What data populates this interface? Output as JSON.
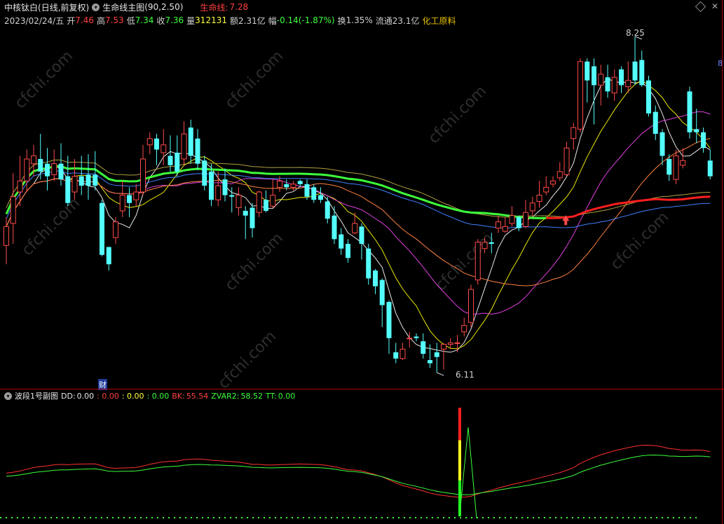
{
  "header": {
    "stock_name": "中核钛白",
    "period_label": "(日线,前复权)",
    "indicator_name": "生命线主图",
    "indicator_params": "(90,2.50)",
    "lifeline_label": "生命线:",
    "lifeline_value": "7.28"
  },
  "info_bar": {
    "date": "2023/02/24/五",
    "open_label": "开",
    "open": "7.46",
    "high_label": "高",
    "high": "7.53",
    "low_label": "低",
    "low": "7.34",
    "close_label": "收",
    "close": "7.36",
    "volume_label": "量",
    "volume": "312131",
    "amount_label": "额",
    "amount": "2.31亿",
    "change_label": "幅",
    "change": "-0.14(-1.87%)",
    "turnover_label": "换",
    "turnover": "1.35%",
    "float_label": "流通",
    "float": "23.1亿",
    "sector": "化工原料"
  },
  "price_annotations": {
    "high": "8.25",
    "low": "6.11"
  },
  "finance_marker": "财",
  "right_axis_label": "8",
  "watermark": "cfchi.com",
  "sub_panel": {
    "title": "波段1号副图",
    "dd_label": "DD:",
    "dd": "0.00",
    "v2": ": 0.00",
    "v3": ": 0.00",
    "v4": ": 0.00",
    "bk_label": "BK:",
    "bk": "55.54",
    "zvar2_label": "ZVAR2:",
    "zvar2": "58.52",
    "tt_label": "TT:",
    "tt": "0.00"
  },
  "colors": {
    "up": "#ff4a4a",
    "down": "#54ffff",
    "lifeline_up": "#ff1e1e",
    "lifeline_down": "#3cff3c",
    "text_red": "#ff4040",
    "text_green": "#3cff3c",
    "text_yellow": "#ffff3c",
    "text_gold": "#e8c000",
    "text_cyan": "#3cffff"
  },
  "chart_data": {
    "type": "candlestick",
    "price_range": [
      6.11,
      8.25
    ],
    "candles": [
      {
        "o": 6.92,
        "c": 7.04,
        "h": 7.1,
        "l": 6.8
      },
      {
        "o": 7.06,
        "c": 7.23,
        "h": 7.38,
        "l": 6.93
      },
      {
        "o": 7.26,
        "c": 7.33,
        "h": 7.49,
        "l": 7.17
      },
      {
        "o": 7.33,
        "c": 7.47,
        "h": 7.53,
        "l": 7.26
      },
      {
        "o": 7.44,
        "c": 7.49,
        "h": 7.56,
        "l": 7.36
      },
      {
        "o": 7.47,
        "c": 7.39,
        "h": 7.63,
        "l": 7.34
      },
      {
        "o": 7.44,
        "c": 7.36,
        "h": 7.54,
        "l": 7.27
      },
      {
        "o": 7.37,
        "c": 7.44,
        "h": 7.53,
        "l": 7.33
      },
      {
        "o": 7.44,
        "c": 7.34,
        "h": 7.57,
        "l": 7.3
      },
      {
        "o": 7.36,
        "c": 7.19,
        "h": 7.49,
        "l": 7.17
      },
      {
        "o": 7.26,
        "c": 7.36,
        "h": 7.47,
        "l": 7.21
      },
      {
        "o": 7.36,
        "c": 7.3,
        "h": 7.49,
        "l": 7.24
      },
      {
        "o": 7.37,
        "c": 7.3,
        "h": 7.5,
        "l": 7.21
      },
      {
        "o": 7.37,
        "c": 7.3,
        "h": 7.52,
        "l": 7.27
      },
      {
        "o": 7.19,
        "c": 6.86,
        "h": 7.21,
        "l": 6.85
      },
      {
        "o": 6.91,
        "c": 6.8,
        "h": 6.91,
        "l": 6.76
      },
      {
        "o": 6.97,
        "c": 7.07,
        "h": 7.1,
        "l": 6.93
      },
      {
        "o": 7.14,
        "c": 7.24,
        "h": 7.33,
        "l": 7.1
      },
      {
        "o": 7.24,
        "c": 7.19,
        "h": 7.29,
        "l": 7.1
      },
      {
        "o": 7.21,
        "c": 7.26,
        "h": 7.31,
        "l": 7.17
      },
      {
        "o": 7.26,
        "c": 7.47,
        "h": 7.56,
        "l": 7.24
      },
      {
        "o": 7.56,
        "c": 7.6,
        "h": 7.64,
        "l": 7.5
      },
      {
        "o": 7.6,
        "c": 7.53,
        "h": 7.63,
        "l": 7.43
      },
      {
        "o": 7.51,
        "c": 7.56,
        "h": 7.66,
        "l": 7.43
      },
      {
        "o": 7.49,
        "c": 7.43,
        "h": 7.62,
        "l": 7.39
      },
      {
        "o": 7.51,
        "c": 7.39,
        "h": 7.62,
        "l": 7.36
      },
      {
        "o": 7.47,
        "c": 7.63,
        "h": 7.71,
        "l": 7.43
      },
      {
        "o": 7.67,
        "c": 7.49,
        "h": 7.72,
        "l": 7.44
      },
      {
        "o": 7.6,
        "c": 7.44,
        "h": 7.66,
        "l": 7.4
      },
      {
        "o": 7.46,
        "c": 7.3,
        "h": 7.49,
        "l": 7.27
      },
      {
        "o": 7.39,
        "c": 7.21,
        "h": 7.44,
        "l": 7.17
      },
      {
        "o": 7.21,
        "c": 7.3,
        "h": 7.39,
        "l": 7.17
      },
      {
        "o": 7.34,
        "c": 7.24,
        "h": 7.41,
        "l": 7.2
      },
      {
        "o": 7.24,
        "c": 7.23,
        "h": 7.29,
        "l": 7.13
      },
      {
        "o": 7.16,
        "c": 7.24,
        "h": 7.29,
        "l": 7.11
      },
      {
        "o": 7.14,
        "c": 7.11,
        "h": 7.17,
        "l": 6.96
      },
      {
        "o": 7.16,
        "c": 7.03,
        "h": 7.19,
        "l": 6.97
      },
      {
        "o": 7.13,
        "c": 7.26,
        "h": 7.27,
        "l": 7.1
      },
      {
        "o": 7.21,
        "c": 7.14,
        "h": 7.27,
        "l": 7.13
      },
      {
        "o": 7.17,
        "c": 7.24,
        "h": 7.34,
        "l": 7.16
      },
      {
        "o": 7.29,
        "c": 7.33,
        "h": 7.36,
        "l": 7.26
      },
      {
        "o": 7.31,
        "c": 7.29,
        "h": 7.34,
        "l": 7.27
      },
      {
        "o": 7.29,
        "c": 7.31,
        "h": 7.33,
        "l": 7.27
      },
      {
        "o": 7.33,
        "c": 7.31,
        "h": 7.34,
        "l": 7.29
      },
      {
        "o": 7.31,
        "c": 7.23,
        "h": 7.34,
        "l": 7.21
      },
      {
        "o": 7.29,
        "c": 7.21,
        "h": 7.31,
        "l": 7.19
      },
      {
        "o": 7.24,
        "c": 7.21,
        "h": 7.29,
        "l": 7.19
      },
      {
        "o": 7.2,
        "c": 7.09,
        "h": 7.23,
        "l": 7.06
      },
      {
        "o": 7.11,
        "c": 6.96,
        "h": 7.17,
        "l": 6.93
      },
      {
        "o": 6.99,
        "c": 6.9,
        "h": 7.03,
        "l": 6.86
      },
      {
        "o": 6.93,
        "c": 6.84,
        "h": 6.96,
        "l": 6.81
      },
      {
        "o": 7.0,
        "c": 7.06,
        "h": 7.13,
        "l": 6.99
      },
      {
        "o": 7.04,
        "c": 6.93,
        "h": 7.06,
        "l": 6.83
      },
      {
        "o": 6.9,
        "c": 6.71,
        "h": 6.93,
        "l": 6.67
      },
      {
        "o": 6.76,
        "c": 6.66,
        "h": 6.77,
        "l": 6.61
      },
      {
        "o": 6.7,
        "c": 6.54,
        "h": 6.71,
        "l": 6.4
      },
      {
        "o": 6.56,
        "c": 6.33,
        "h": 6.57,
        "l": 6.23
      },
      {
        "o": 6.24,
        "c": 6.2,
        "h": 6.3,
        "l": 6.17
      },
      {
        "o": 6.2,
        "c": 6.26,
        "h": 6.3,
        "l": 6.19
      },
      {
        "o": 6.33,
        "c": 6.33,
        "h": 6.37,
        "l": 6.27
      },
      {
        "o": 6.34,
        "c": 6.33,
        "h": 6.36,
        "l": 6.31
      },
      {
        "o": 6.31,
        "c": 6.23,
        "h": 6.36,
        "l": 6.2
      },
      {
        "o": 6.19,
        "c": 6.17,
        "h": 6.29,
        "l": 6.14
      },
      {
        "o": 6.24,
        "c": 6.21,
        "h": 6.3,
        "l": 6.11
      },
      {
        "o": 6.26,
        "c": 6.29,
        "h": 6.3,
        "l": 6.13
      },
      {
        "o": 6.29,
        "c": 6.3,
        "h": 6.33,
        "l": 6.26
      },
      {
        "o": 6.3,
        "c": 6.3,
        "h": 6.35,
        "l": 6.24
      },
      {
        "o": 6.37,
        "c": 6.41,
        "h": 6.46,
        "l": 6.34
      },
      {
        "o": 6.43,
        "c": 6.64,
        "h": 6.67,
        "l": 6.4
      },
      {
        "o": 6.7,
        "c": 6.94,
        "h": 6.96,
        "l": 6.67
      },
      {
        "o": 6.9,
        "c": 6.94,
        "h": 6.97,
        "l": 6.87
      },
      {
        "o": 6.94,
        "c": 6.93,
        "h": 7.0,
        "l": 6.87
      },
      {
        "o": 7.03,
        "c": 7.07,
        "h": 7.11,
        "l": 7.0
      },
      {
        "o": 7.01,
        "c": 7.04,
        "h": 7.1,
        "l": 7.0
      },
      {
        "o": 7.06,
        "c": 7.11,
        "h": 7.17,
        "l": 7.04
      },
      {
        "o": 7.1,
        "c": 7.03,
        "h": 7.11,
        "l": 7.01
      },
      {
        "o": 7.04,
        "c": 7.13,
        "h": 7.21,
        "l": 7.03
      },
      {
        "o": 7.14,
        "c": 7.19,
        "h": 7.23,
        "l": 7.11
      },
      {
        "o": 7.2,
        "c": 7.24,
        "h": 7.33,
        "l": 7.16
      },
      {
        "o": 7.26,
        "c": 7.29,
        "h": 7.36,
        "l": 7.24
      },
      {
        "o": 7.31,
        "c": 7.33,
        "h": 7.36,
        "l": 7.29
      },
      {
        "o": 7.35,
        "c": 7.39,
        "h": 7.45,
        "l": 7.33
      },
      {
        "o": 7.37,
        "c": 7.54,
        "h": 7.58,
        "l": 7.36
      },
      {
        "o": 7.6,
        "c": 7.67,
        "h": 7.7,
        "l": 7.53
      },
      {
        "o": 7.66,
        "c": 8.09,
        "h": 8.11,
        "l": 7.64
      },
      {
        "o": 8.09,
        "c": 7.97,
        "h": 8.11,
        "l": 7.83
      },
      {
        "o": 8.06,
        "c": 7.94,
        "h": 8.11,
        "l": 7.69
      },
      {
        "o": 7.94,
        "c": 8.01,
        "h": 8.07,
        "l": 7.81
      },
      {
        "o": 7.99,
        "c": 7.9,
        "h": 8.07,
        "l": 7.86
      },
      {
        "o": 7.89,
        "c": 7.99,
        "h": 8.04,
        "l": 7.84
      },
      {
        "o": 8.04,
        "c": 7.94,
        "h": 8.06,
        "l": 7.89
      },
      {
        "o": 7.93,
        "c": 7.97,
        "h": 8.09,
        "l": 7.89
      },
      {
        "o": 8.09,
        "c": 7.97,
        "h": 8.25,
        "l": 7.94
      },
      {
        "o": 8.1,
        "c": 7.94,
        "h": 8.16,
        "l": 7.93
      },
      {
        "o": 7.97,
        "c": 7.76,
        "h": 8.0,
        "l": 7.74
      },
      {
        "o": 7.77,
        "c": 7.63,
        "h": 7.81,
        "l": 7.59
      },
      {
        "o": 7.64,
        "c": 7.49,
        "h": 7.66,
        "l": 7.43
      },
      {
        "o": 7.47,
        "c": 7.37,
        "h": 7.5,
        "l": 7.33
      },
      {
        "o": 7.34,
        "c": 7.49,
        "h": 7.53,
        "l": 7.31
      },
      {
        "o": 7.43,
        "c": 7.46,
        "h": 7.54,
        "l": 7.41
      },
      {
        "o": 7.9,
        "c": 7.64,
        "h": 7.93,
        "l": 7.6
      },
      {
        "o": 7.66,
        "c": 7.64,
        "h": 7.79,
        "l": 7.57
      },
      {
        "o": 7.64,
        "c": 7.54,
        "h": 7.67,
        "l": 7.51
      },
      {
        "o": 7.46,
        "c": 7.36,
        "h": 7.53,
        "l": 7.34
      }
    ]
  }
}
